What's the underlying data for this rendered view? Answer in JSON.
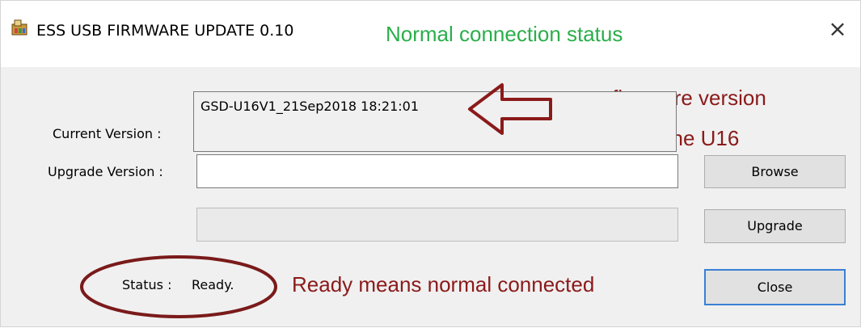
{
  "window": {
    "title": "ESS USB FIRMWARE UPDATE 0.10",
    "close_glyph": "×",
    "app_icon": "app-icon"
  },
  "form": {
    "current_version_label": "Current Version :",
    "current_version_value": "GSD-U16V1_21Sep2018 18:21:01",
    "upgrade_version_label": "Upgrade Version :",
    "upgrade_version_value": "",
    "progress_value": "",
    "status_label": "Status :",
    "status_value": "Ready."
  },
  "buttons": {
    "browse": "Browse",
    "upgrade": "Upgrade",
    "close": "Close"
  },
  "annotations": {
    "connection_status": "Normal connection status",
    "firmware_line1": "current firmware version",
    "firmware_line2": "number of the U16",
    "ready_note": "Ready means normal connected",
    "colors": {
      "green": "#2aae4a",
      "red": "#8b1a1a"
    }
  }
}
